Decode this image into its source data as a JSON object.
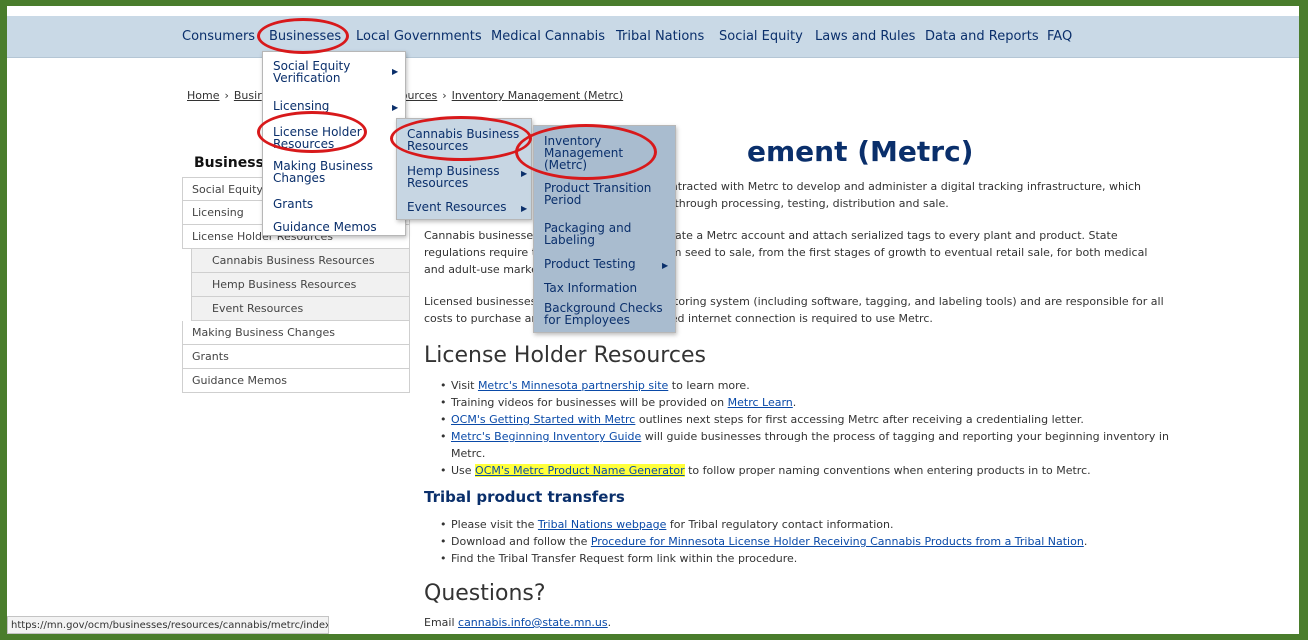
{
  "topnav": [
    "Consumers",
    "Businesses",
    "Local Governments",
    "Medical Cannabis",
    "Tribal Nations",
    "Social Equity",
    "Laws and Rules",
    "Data and Reports",
    "FAQ"
  ],
  "breadcrumb": {
    "home": "Home",
    "businesses": "Busir",
    "resources": "sources",
    "current": "Inventory Management (Metrc)"
  },
  "sidebar": {
    "title": "Businesse",
    "items": [
      "Social Equity V",
      "Licensing",
      "License Holder Resources",
      "Cannabis Business Resources",
      "Hemp Business Resources",
      "Event Resources",
      "Making Business Changes",
      "Grants",
      "Guidance Memos"
    ]
  },
  "menu1": [
    "Social Equity Verification",
    "Licensing",
    "License Holder Resources",
    "Making Business Changes",
    "Grants",
    "Guidance Memos"
  ],
  "menu2": [
    "Cannabis Business Resources",
    "Hemp Business Resources",
    "Event Resources"
  ],
  "menu3": [
    "Inventory Management (Metrc)",
    "Product Transition Period",
    "Packaging and Labeling",
    "Product Testing",
    "Tax Information",
    "Background Checks for Employees"
  ],
  "main": {
    "h1": "ement (Metrc)",
    "intro1a": "ontracted with Metrc to develop and administer a digital tracking infrastructure, which",
    "intro1b": "n through processing, testing, distribution and sale.",
    "intro2a_l": "Cannabis businesses",
    "intro2a_r": "reate a Metrc account and attach serialized tags to every plant and product. State",
    "intro2b_l": "regulations require th",
    "intro2b_r": "om seed to sale, from the first stages of growth to eventual retail sale, for both medical",
    "intro2c": "and adult-use market",
    "intro3a_l": "Licensed businesses r",
    "intro3a_r": "nitoring system (including software, tagging, and labeling tools) and are responsible for all",
    "intro3b_l": "costs to purchase and",
    "intro3b_r": "eed internet connection is required to use Metrc.",
    "h2_resources": "License Holder Resources",
    "res": {
      "b1_pre": "Visit ",
      "b1_link": "Metrc's Minnesota partnership site",
      "b1_post": " to learn more.",
      "b2_pre": "Training videos for businesses will be provided on ",
      "b2_link": "Metrc Learn",
      "b2_post": ".",
      "b3_link": "OCM's Getting Started with Metrc",
      "b3_post": " outlines next steps for first accessing Metrc after receiving a credentialing letter.",
      "b4_link": "Metrc's Beginning Inventory Guide",
      "b4_post": " will guide businesses through the process of tagging and reporting your beginning inventory in",
      "b4_cont": "Metrc.",
      "b5_pre": "Use ",
      "b5_link": "OCM's Metrc Product Name Generator",
      "b5_post": " to follow proper naming conventions when entering products in to Metrc."
    },
    "h3_tribal": "Tribal product transfers",
    "tribal": {
      "b1_pre": "Please visit the ",
      "b1_link": "Tribal Nations webpage",
      "b1_post": " for Tribal regulatory contact information.",
      "b2_pre": "Download and follow the ",
      "b2_link": "Procedure for Minnesota License Holder Receiving Cannabis Products from a Tribal Nation",
      "b2_post": ".",
      "b3": "Find the Tribal Transfer Request form link within the procedure."
    },
    "h2_questions": "Questions?",
    "email_pre": "Email ",
    "email_link": "cannabis.info@state.mn.us",
    "email_post": "."
  },
  "status_url": "https://mn.gov/ocm/businesses/resources/cannabis/metrc/index.jsp",
  "colors": {
    "frame": "#4a7d2c",
    "nav": "#c9d9e6",
    "navy": "#0a2f6b",
    "annotation": "#d8191b",
    "highlight": "#ffff3b"
  }
}
